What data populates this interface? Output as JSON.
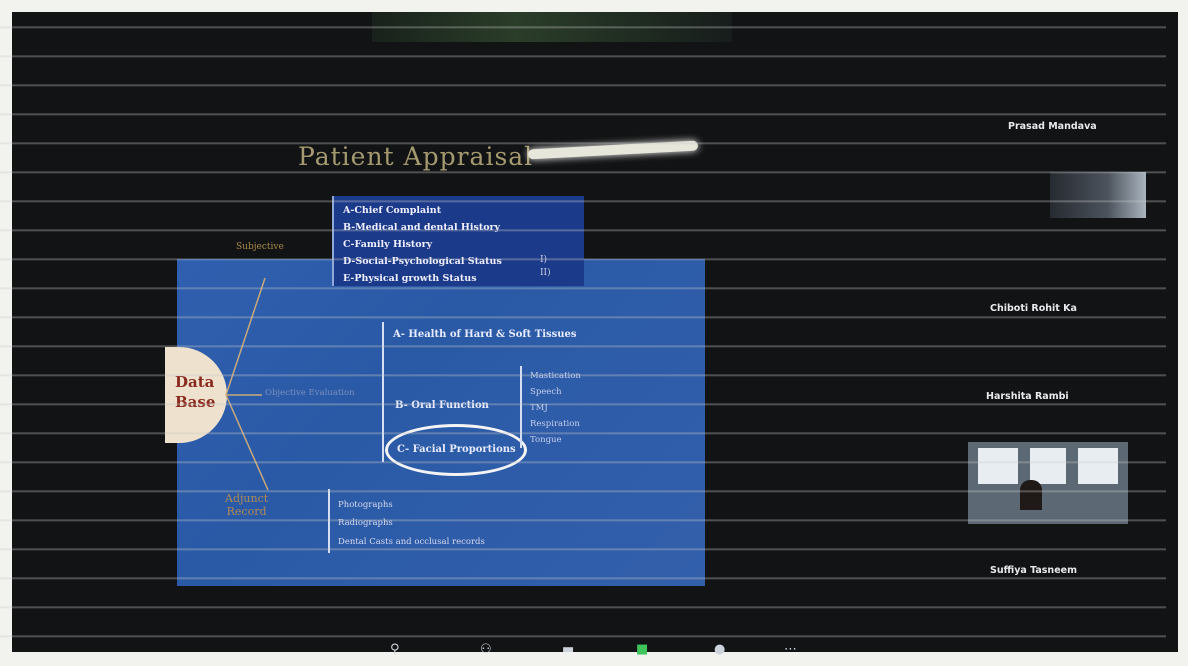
{
  "slide": {
    "title": "Patient Appraisal",
    "subjective_label": "Subjective",
    "history_items": [
      "A-Chief Complaint",
      "B-Medical and dental History",
      "C-Family History",
      "D-Social-Psychological Status",
      "E-Physical growth Status"
    ],
    "history_extra": [
      "I)",
      "II)"
    ],
    "data_base": [
      "Data",
      "Base"
    ],
    "objective_label": "Objective Evaluation",
    "sections": {
      "a": "A- Health of Hard & Soft Tissues",
      "b": "B- Oral Function",
      "c": "C- Facial Proportions"
    },
    "oral_function_items": [
      "Mastication",
      "Speech",
      "TMJ",
      "Respiration",
      "Tongue"
    ],
    "adjunct_label": [
      "Adjunct",
      "Record"
    ],
    "adjunct_items": [
      "Photographs",
      "Radiographs",
      "Dental Casts and occlusal records"
    ]
  },
  "participants": [
    {
      "name": "Prasad Mandava"
    },
    {
      "name": "Chiboti Rohit Ka"
    },
    {
      "name": "Harshita Rambi"
    },
    {
      "name": "Suffiya Tasneem"
    }
  ],
  "toolbar": {
    "icons": [
      "mic-icon",
      "participants-icon",
      "chat-icon",
      "share-screen-icon",
      "record-icon",
      "more-icon"
    ]
  }
}
